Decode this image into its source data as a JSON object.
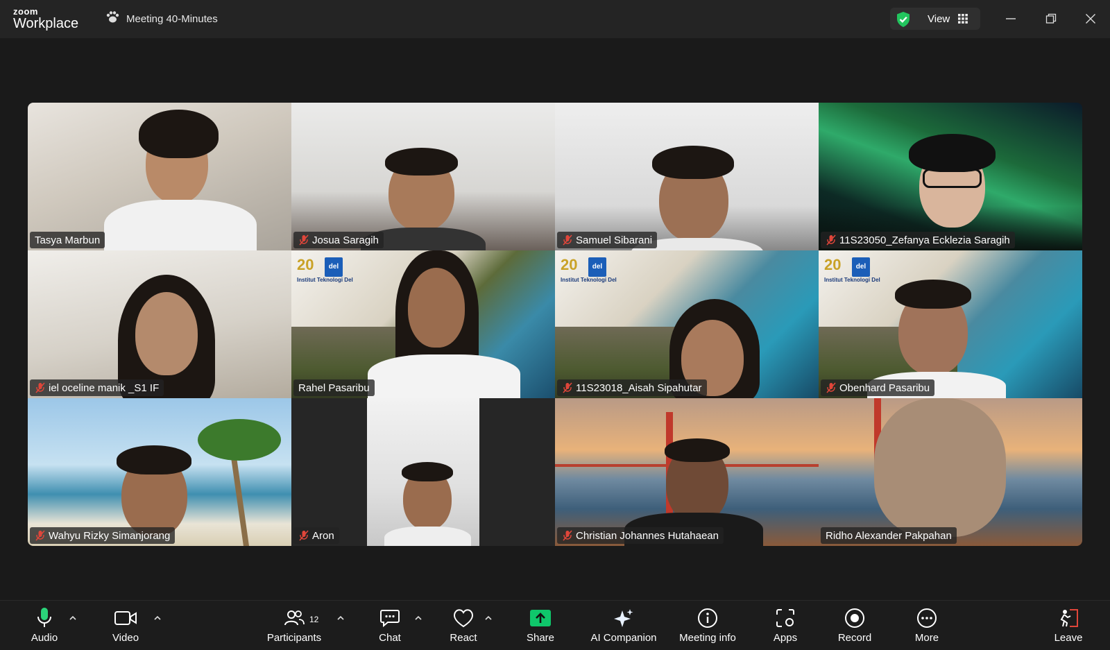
{
  "app": {
    "logo_line1": "zoom",
    "logo_line2": "Workplace"
  },
  "header": {
    "meeting_title": "Meeting 40-Minutes",
    "view_label": "View"
  },
  "participants": [
    {
      "name": "Tasya Marbun",
      "muted": false
    },
    {
      "name": "Josua Saragih",
      "muted": true
    },
    {
      "name": "Samuel Sibarani",
      "muted": true
    },
    {
      "name": "11S23050_Zefanya Ecklezia Saragih",
      "muted": true
    },
    {
      "name": "iel oceline manik _S1 IF",
      "muted": true
    },
    {
      "name": "Rahel Pasaribu",
      "muted": false,
      "active_speaker": true
    },
    {
      "name": "11S23018_Aisah Sipahutar",
      "muted": true
    },
    {
      "name": "Obenhard Pasaribu",
      "muted": true
    },
    {
      "name": "Wahyu Rizky Simanjorang",
      "muted": true
    },
    {
      "name": "Aron",
      "muted": true
    },
    {
      "name": "Christian Johannes Hutahaean",
      "muted": true
    },
    {
      "name": "Ridho Alexander Pakpahan",
      "muted": false
    }
  ],
  "background": {
    "campus_title": "Institut Teknologi Del",
    "logo_text": "del",
    "anniversary": "20"
  },
  "toolbar": {
    "audio": "Audio",
    "video": "Video",
    "participants": "Participants",
    "participants_count": "12",
    "chat": "Chat",
    "react": "React",
    "share": "Share",
    "ai_companion": "AI Companion",
    "meeting_info": "Meeting info",
    "apps": "Apps",
    "record": "Record",
    "more": "More",
    "leave": "Leave"
  },
  "colors": {
    "accent_green": "#25d07a",
    "share_green": "#0fc76b",
    "mute_red": "#e0463a",
    "leave_red": "#e0463a"
  }
}
